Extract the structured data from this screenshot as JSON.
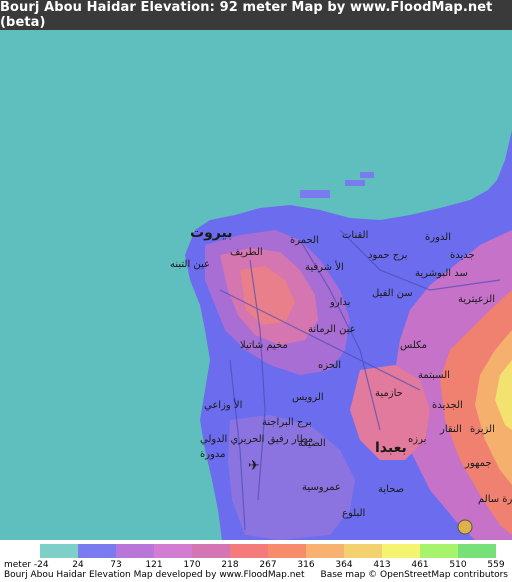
{
  "title": "Bourj Abou Haidar Elevation: 92 meter Map by www.FloodMap.net (beta)",
  "map": {
    "place_labels": [
      {
        "text": "بيروت",
        "size": "big"
      },
      {
        "text": "الطريف",
        "size": "normal"
      },
      {
        "text": "الحمرة",
        "size": "normal"
      },
      {
        "text": "عين التبنه",
        "size": "normal"
      },
      {
        "text": "الأ شرفية",
        "size": "normal"
      },
      {
        "text": "القنات",
        "size": "normal"
      },
      {
        "text": "برج حمود",
        "size": "normal"
      },
      {
        "text": "الدورة",
        "size": "normal"
      },
      {
        "text": "جديدة",
        "size": "normal"
      },
      {
        "text": "سد البوشرية",
        "size": "normal"
      },
      {
        "text": "بدارو",
        "size": "normal"
      },
      {
        "text": "سن الفيل",
        "size": "normal"
      },
      {
        "text": "الزعيترية",
        "size": "normal"
      },
      {
        "text": "عين الرمانة",
        "size": "normal"
      },
      {
        "text": "مخيم شاتيلا",
        "size": "normal"
      },
      {
        "text": "مكلس",
        "size": "normal"
      },
      {
        "text": "الحزه",
        "size": "normal"
      },
      {
        "text": "السبتمة",
        "size": "normal"
      },
      {
        "text": "حازمية",
        "size": "normal"
      },
      {
        "text": "الجديدة",
        "size": "normal"
      },
      {
        "text": "الرويس",
        "size": "normal"
      },
      {
        "text": "الأ وزاعي",
        "size": "normal"
      },
      {
        "text": "برج البراجنة",
        "size": "normal"
      },
      {
        "text": "برزه",
        "size": "normal"
      },
      {
        "text": "النقار",
        "size": "normal"
      },
      {
        "text": "الزبرة",
        "size": "normal"
      },
      {
        "text": "بعبدا",
        "size": "big"
      },
      {
        "text": "الضيعة",
        "size": "normal"
      },
      {
        "text": "مدورة",
        "size": "normal"
      },
      {
        "text": "جمهور",
        "size": "normal"
      },
      {
        "text": "عمروسية",
        "size": "normal"
      },
      {
        "text": "صحاية",
        "size": "normal"
      },
      {
        "text": "البلوع",
        "size": "normal"
      },
      {
        "text": "حارة سالم",
        "size": "normal"
      },
      {
        "text": "مطار رفيق الحريري الدولي",
        "size": "normal"
      }
    ]
  },
  "legend": {
    "unit_label": "meter",
    "ticks": [
      "-24",
      "24",
      "73",
      "121",
      "170",
      "218",
      "267",
      "316",
      "364",
      "413",
      "461",
      "510",
      "559"
    ],
    "colors": [
      "#7ecfc8",
      "#7b7bf0",
      "#b877d8",
      "#d27cd2",
      "#d476b4",
      "#f47b7b",
      "#f68c6c",
      "#f7b271",
      "#f3d16e",
      "#f4f471",
      "#a8f36c",
      "#78e078"
    ]
  },
  "footer": {
    "left_text": "Bourj Abou Haidar Elevation Map developed by www.FloodMap.net",
    "right_text": "Base map © OpenStreetMap contributors"
  }
}
